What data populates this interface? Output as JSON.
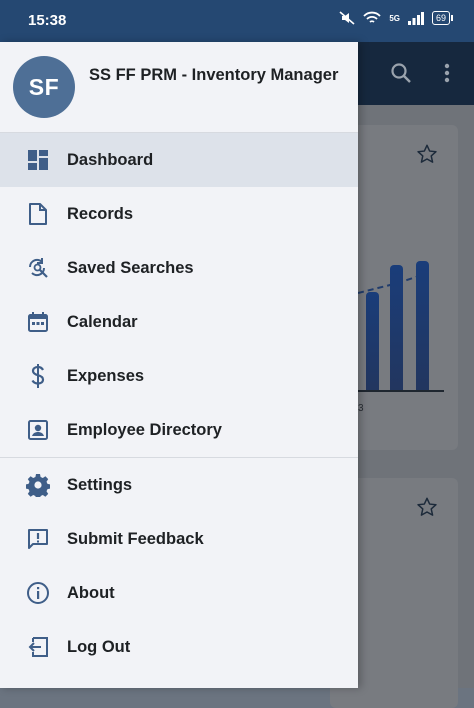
{
  "status_bar": {
    "time": "15:38",
    "battery": "69",
    "network_type": "5G",
    "icons": [
      "mute-icon",
      "wifi-icon",
      "signal-icon",
      "battery-icon"
    ]
  },
  "colors": {
    "status_bar": "#254872",
    "drawer_bg": "#f2f3f7",
    "active_item_bg": "#dde2ea",
    "avatar_bg": "#4e6f96",
    "icon": "#3f5e88"
  },
  "account": {
    "initials": "SF",
    "name": "SS FF PRM - Inventory Manager"
  },
  "menu": {
    "primary": [
      {
        "label": "Dashboard",
        "icon": "dashboard-icon",
        "active": true
      },
      {
        "label": "Records",
        "icon": "document-icon",
        "active": false
      },
      {
        "label": "Saved Searches",
        "icon": "saved-search-icon",
        "active": false
      },
      {
        "label": "Calendar",
        "icon": "calendar-icon",
        "active": false
      },
      {
        "label": "Expenses",
        "icon": "dollar-icon",
        "active": false
      },
      {
        "label": "Employee Directory",
        "icon": "contact-card-icon",
        "active": false
      }
    ],
    "secondary": [
      {
        "label": "Settings",
        "icon": "gear-icon"
      },
      {
        "label": "Submit Feedback",
        "icon": "feedback-icon"
      },
      {
        "label": "About",
        "icon": "info-icon"
      },
      {
        "label": "Log Out",
        "icon": "logout-icon"
      }
    ]
  },
  "background_app": {
    "toolbar_icons": [
      "search-icon",
      "more-vert-icon"
    ],
    "chart_tick": "3",
    "bar_levels": [
      0.65,
      0.83,
      0.86
    ]
  }
}
